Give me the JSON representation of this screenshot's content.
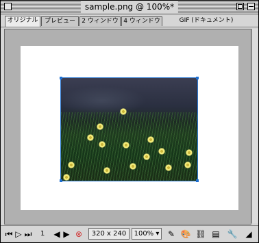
{
  "window": {
    "title": "sample.png @ 100%*"
  },
  "tabs": [
    {
      "label": "オリジナル",
      "active": true
    },
    {
      "label": "プレビュー",
      "active": false
    },
    {
      "label": "2 ウィンドウ",
      "active": false
    },
    {
      "label": "4 ウィンドウ",
      "active": false
    }
  ],
  "format_label": "GIF (ドキュメント)",
  "statusbar": {
    "frame_number": "1",
    "image_size": "320 x 240",
    "zoom": "100%"
  },
  "colors": {
    "selection": "#2d7bd6",
    "canvas": "#ffffff",
    "pasteboard": "#b0b0b0"
  }
}
